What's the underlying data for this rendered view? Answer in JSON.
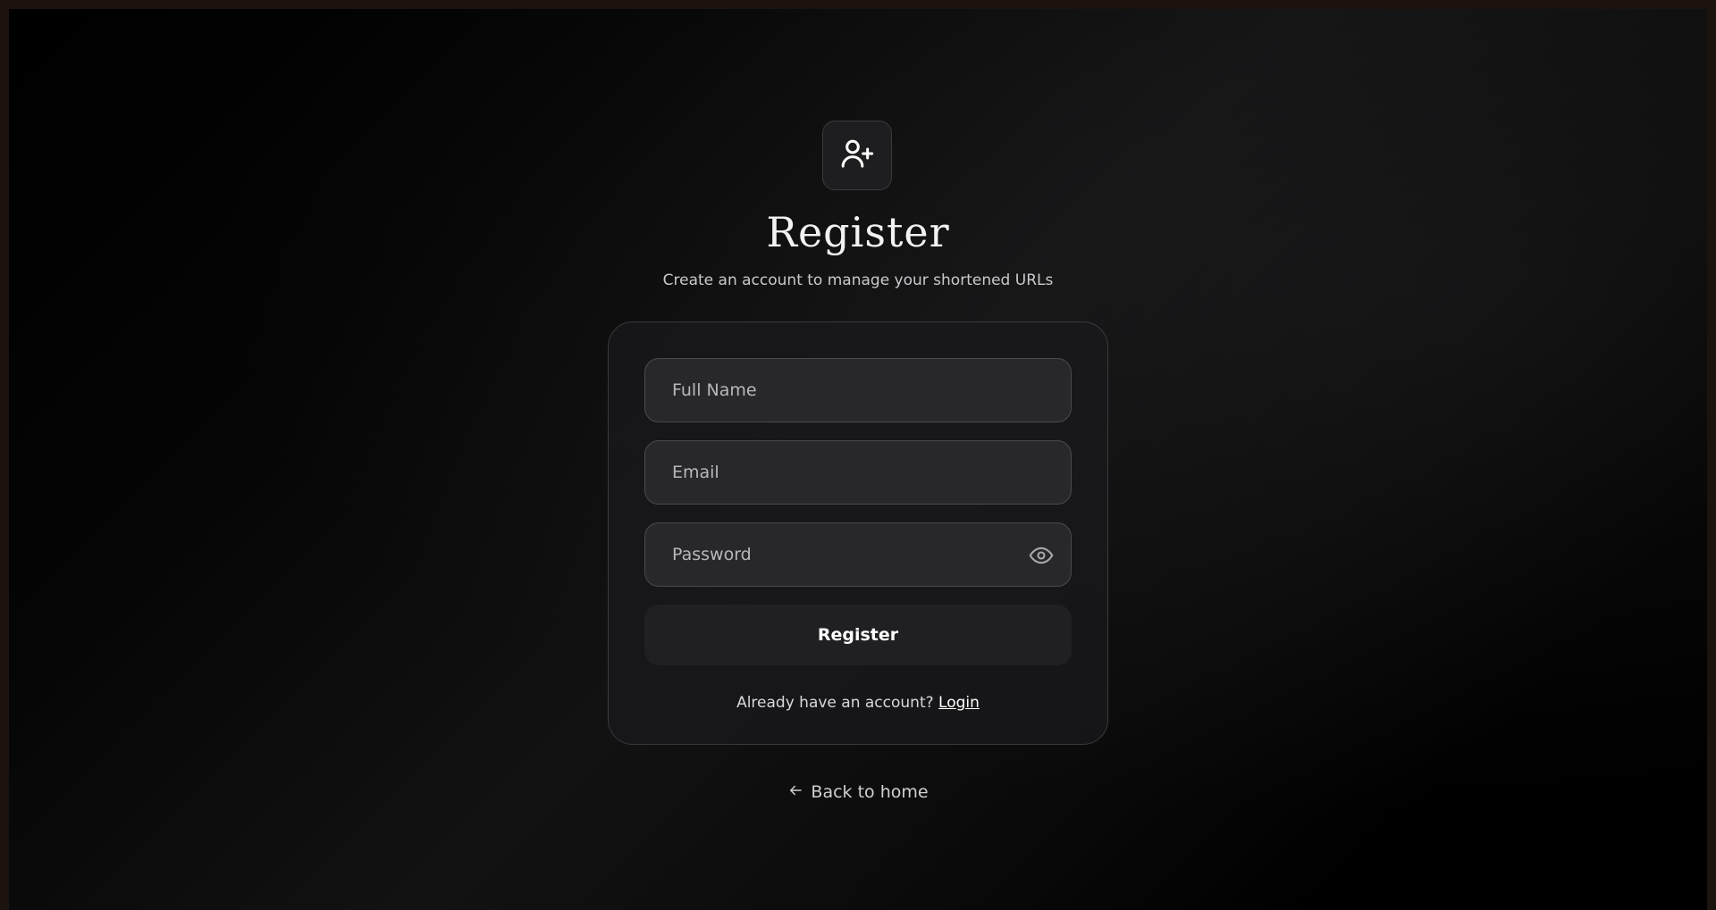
{
  "header": {
    "icon": "user-plus-icon",
    "title": "Register",
    "subtitle": "Create an account to manage your shortened URLs"
  },
  "form": {
    "full_name": {
      "placeholder": "Full Name",
      "value": ""
    },
    "email": {
      "placeholder": "Email",
      "value": ""
    },
    "password": {
      "placeholder": "Password",
      "value": "",
      "toggle_icon": "eye-icon"
    },
    "submit_label": "Register",
    "login_prompt": "Already have an account?",
    "login_link": "Login"
  },
  "footer": {
    "back_icon": "arrow-left-icon",
    "back_label": "Back to home"
  },
  "colors": {
    "background": "#000000",
    "card_border": "#3a3a3e",
    "input_bg": "#28282b",
    "button_bg": "#202023",
    "text": "#f2f2f2"
  }
}
